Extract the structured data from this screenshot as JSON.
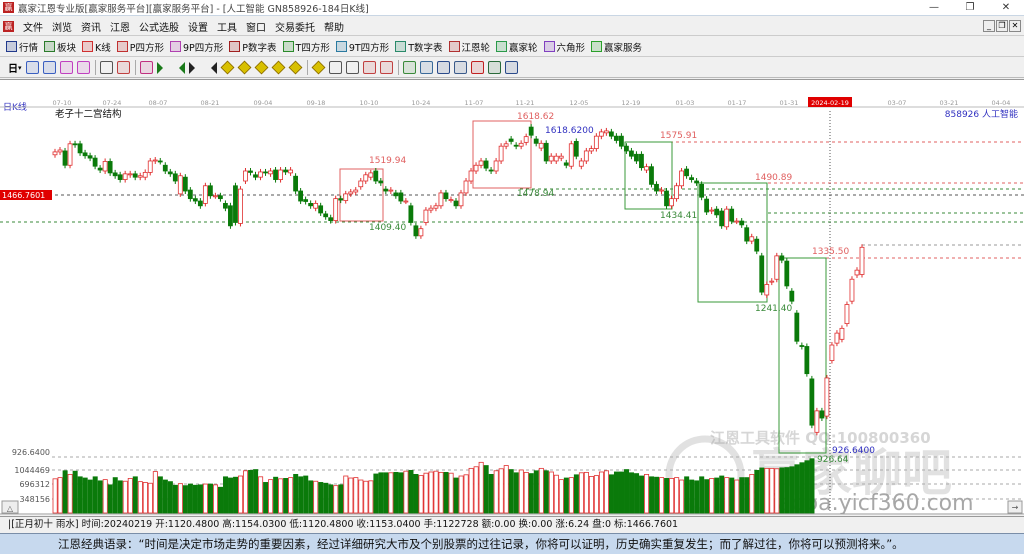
{
  "window": {
    "title": "赢家江恩专业版[赢家服务平台][赢家服务平台] - [人工智能  GN858926-184日K线]",
    "controls": [
      "—",
      "❐",
      "✕"
    ]
  },
  "menu": [
    "文件",
    "浏览",
    "资讯",
    "江恩",
    "公式选股",
    "设置",
    "工具",
    "窗口",
    "交易委托",
    "帮助"
  ],
  "toolbar1": [
    {
      "label": "行情",
      "icon": "quotes-icon",
      "color": "#223a8c"
    },
    {
      "label": "板块",
      "icon": "sector-icon",
      "color": "#2a7a2a"
    },
    {
      "label": "K线",
      "icon": "kline-icon",
      "color": "#d03030"
    },
    {
      "label": "P四方形",
      "icon": "p-square-icon",
      "color": "#c03030"
    },
    {
      "label": "9P四方形",
      "icon": "9p-square-icon",
      "color": "#b040b0"
    },
    {
      "label": "P数字表",
      "icon": "p-number-table-icon",
      "color": "#a02020"
    },
    {
      "label": "T四方形",
      "icon": "t-square-icon",
      "color": "#2a8a2a"
    },
    {
      "label": "9T四方形",
      "icon": "9t-square-icon",
      "color": "#2a7aa0"
    },
    {
      "label": "T数字表",
      "icon": "t-number-table-icon",
      "color": "#2a8a6a"
    },
    {
      "label": "江恩轮",
      "icon": "gann-wheel-icon",
      "color": "#b03030"
    },
    {
      "label": "赢家轮",
      "icon": "winner-wheel-icon",
      "color": "#2a9a4a"
    },
    {
      "label": "六角形",
      "icon": "hexagon-icon",
      "color": "#8040c0"
    },
    {
      "label": "赢家服务",
      "icon": "dollar-icon",
      "color": "#2aa02a"
    }
  ],
  "toolbar2": {
    "period": "日",
    "icons": [
      "overlay-icon",
      "info-icon",
      "indicator-icon",
      "indicator2-icon",
      "candle-type-icon",
      "right-icon",
      "flag-icon",
      "first-icon",
      "last-icon",
      "prev-icon",
      "next-icon",
      "zoom-in-icon",
      "zoom-out-icon",
      "shift-left-icon",
      "shift-right-icon",
      "expand-icon",
      "shrink-icon",
      "hand-icon",
      "crosshair-icon",
      "draw-line-icon",
      "pattern-icon",
      "gann-icon",
      "calendar-icon",
      "calculator-icon",
      "report-icon",
      "save-icon",
      "network-icon",
      "print-icon"
    ]
  },
  "chart": {
    "period_label": "日K线",
    "indicator_name": "老子十二宫结构",
    "symbol": "858926 人工智能",
    "current_price_tag": "1466.7601",
    "date_ticks": [
      "07-10",
      "07-24",
      "08-07",
      "08-21",
      "09-04",
      "09-18",
      "10-10",
      "10-24",
      "11-07",
      "11-21",
      "12-05",
      "12-19",
      "01-03",
      "01-17",
      "01-31",
      "2024-02-19",
      "03-07",
      "03-21",
      "04-04"
    ],
    "price_labels": {
      "a": "1519.94",
      "b": "1409.40",
      "c": "1618.62",
      "d": "1618.6200",
      "e": "1478.94",
      "f": "1575.91",
      "g": "1434.41",
      "h": "1490.89",
      "i": "1241.40",
      "j": "1335.50",
      "k": "926.6400",
      "l": "926.64"
    },
    "volume_axis": {
      "max_label": "926.6400",
      "ticks": [
        "1044469",
        "696312",
        "348156"
      ]
    },
    "watermark": {
      "line1": "江恩工具软件  QQ:100800360",
      "brand": "赢家聊吧",
      "site": "liaoba.yicf360.com"
    },
    "colors": {
      "up": "#e03030",
      "down": "#0a7a0a",
      "box_up": "#e06060",
      "box_down": "#3a9a3a",
      "tag": "#e00000",
      "blue": "#3030c0"
    }
  },
  "chart_data": {
    "type": "candlestick",
    "price_format": "[open, close]",
    "candles": [
      [
        1552,
        1558
      ],
      [
        1558,
        1562
      ],
      [
        1560,
        1530
      ],
      [
        1530,
        1575
      ],
      [
        1575,
        1573
      ],
      [
        1575,
        1556
      ],
      [
        1556,
        1550
      ],
      [
        1550,
        1545
      ],
      [
        1545,
        1528
      ],
      [
        1524,
        1520
      ],
      [
        1518,
        1538
      ],
      [
        1538,
        1514
      ],
      [
        1514,
        1508
      ],
      [
        1510,
        1500
      ],
      [
        1500,
        1512
      ],
      [
        1510,
        1512
      ],
      [
        1512,
        1505
      ],
      [
        1505,
        1508
      ],
      [
        1505,
        1515
      ],
      [
        1515,
        1539
      ],
      [
        1539,
        1541
      ],
      [
        1539,
        1538
      ],
      [
        1530,
        1518
      ],
      [
        1516,
        1512
      ],
      [
        1512,
        1497
      ],
      [
        1470,
        1508
      ],
      [
        1505,
        1476
      ],
      [
        1478,
        1460
      ],
      [
        1460,
        1455
      ],
      [
        1455,
        1445
      ],
      [
        1450,
        1487
      ],
      [
        1487,
        1466
      ],
      [
        1466,
        1466
      ],
      [
        1466,
        1460
      ],
      [
        1450,
        1440
      ],
      [
        1445,
        1403
      ],
      [
        1487,
        1410
      ],
      [
        1408,
        1480
      ],
      [
        1497,
        1518
      ],
      [
        1518,
        1515
      ],
      [
        1510,
        1505
      ],
      [
        1505,
        1516
      ],
      [
        1516,
        1514
      ],
      [
        1512,
        1518
      ],
      [
        1520,
        1500
      ],
      [
        1500,
        1520
      ],
      [
        1520,
        1516
      ],
      [
        1514,
        1520
      ],
      [
        1507,
        1476
      ],
      [
        1476,
        1455
      ],
      [
        1458,
        1454
      ],
      [
        1450,
        1445
      ],
      [
        1440,
        1450
      ],
      [
        1445,
        1430
      ],
      [
        1428,
        1422
      ],
      [
        1420,
        1414
      ],
      [
        1414,
        1460
      ],
      [
        1460,
        1457
      ],
      [
        1456,
        1470
      ],
      [
        1470,
        1474
      ],
      [
        1474,
        1478
      ],
      [
        1485,
        1497
      ],
      [
        1497,
        1510
      ],
      [
        1505,
        1514
      ],
      [
        1518,
        1497
      ],
      [
        1497,
        1493
      ],
      [
        1480,
        1476
      ],
      [
        1476,
        1478
      ],
      [
        1472,
        1466
      ],
      [
        1472,
        1455
      ],
      [
        1455,
        1455
      ],
      [
        1445,
        1410
      ],
      [
        1403,
        1382
      ],
      [
        1382,
        1397
      ],
      [
        1410,
        1436
      ],
      [
        1436,
        1440
      ],
      [
        1440,
        1445
      ],
      [
        1445,
        1472
      ],
      [
        1472,
        1460
      ],
      [
        1458,
        1458
      ],
      [
        1455,
        1445
      ],
      [
        1445,
        1472
      ],
      [
        1472,
        1497
      ],
      [
        1497,
        1518
      ],
      [
        1518,
        1530
      ],
      [
        1530,
        1539
      ],
      [
        1539,
        1524
      ],
      [
        1520,
        1518
      ],
      [
        1518,
        1539
      ],
      [
        1539,
        1570
      ],
      [
        1570,
        1575
      ],
      [
        1585,
        1580
      ],
      [
        1572,
        1570
      ],
      [
        1570,
        1576
      ],
      [
        1578,
        1590
      ],
      [
        1610,
        1593
      ],
      [
        1585,
        1576
      ],
      [
        1566,
        1576
      ],
      [
        1576,
        1539
      ],
      [
        1539,
        1549
      ],
      [
        1539,
        1549
      ],
      [
        1545,
        1549
      ],
      [
        1535,
        1530
      ],
      [
        1528,
        1575
      ],
      [
        1580,
        1549
      ],
      [
        1528,
        1539
      ],
      [
        1539,
        1560
      ],
      [
        1560,
        1565
      ],
      [
        1565,
        1591
      ],
      [
        1591,
        1600
      ],
      [
        1598,
        1602
      ],
      [
        1600,
        1591
      ],
      [
        1591,
        1582
      ],
      [
        1591,
        1570
      ],
      [
        1570,
        1560
      ],
      [
        1560,
        1549
      ],
      [
        1553,
        1539
      ],
      [
        1553,
        1525
      ],
      [
        1520,
        1527
      ],
      [
        1527,
        1490
      ],
      [
        1490,
        1476
      ],
      [
        1476,
        1478
      ],
      [
        1476,
        1445
      ],
      [
        1445,
        1460
      ],
      [
        1460,
        1487
      ],
      [
        1487,
        1518
      ],
      [
        1522,
        1508
      ],
      [
        1504,
        1500
      ],
      [
        1497,
        1493
      ],
      [
        1490,
        1463
      ],
      [
        1459,
        1432
      ],
      [
        1434,
        1436
      ],
      [
        1438,
        1426
      ],
      [
        1434,
        1403
      ],
      [
        1401,
        1438
      ],
      [
        1438,
        1413
      ],
      [
        1413,
        1413
      ],
      [
        1413,
        1405
      ],
      [
        1399,
        1371
      ],
      [
        1371,
        1380
      ],
      [
        1375,
        1350
      ],
      [
        1340,
        1264
      ],
      [
        1258,
        1280
      ],
      [
        1285,
        1287
      ],
      [
        1291,
        1340
      ],
      [
        1340,
        1331
      ],
      [
        1329,
        1277
      ],
      [
        1266,
        1245
      ],
      [
        1220,
        1161
      ],
      [
        1152,
        1150
      ],
      [
        1150,
        1093
      ],
      [
        1082,
        985
      ],
      [
        970,
        1015
      ],
      [
        1015,
        1000
      ],
      [
        1004,
        1084
      ],
      [
        1120.48,
        1153.04
      ],
      [
        1157,
        1178
      ],
      [
        1165,
        1188
      ],
      [
        1198,
        1238
      ],
      [
        1245,
        1291
      ],
      [
        1300,
        1310
      ],
      [
        1301,
        1358
      ]
    ],
    "volumes": [
      850000,
      880000,
      1050000,
      960000,
      1040000,
      900000,
      870000,
      820000,
      900000,
      800000,
      830000,
      700000,
      880000,
      800000,
      790000,
      860000,
      900000,
      780000,
      760000,
      740000,
      1030000,
      900000,
      820000,
      780000,
      690000,
      730000,
      680000,
      720000,
      690000,
      700000,
      720000,
      720000,
      700000,
      640000,
      900000,
      870000,
      890000,
      920000,
      1050000,
      1060000,
      1080000,
      900000,
      760000,
      830000,
      890000,
      850000,
      860000,
      880000,
      960000,
      900000,
      920000,
      800000,
      790000,
      760000,
      740000,
      700000,
      680000,
      700000,
      920000,
      870000,
      880000,
      820000,
      790000,
      800000,
      970000,
      1000000,
      1000000,
      1000000,
      1010000,
      1000000,
      1040000,
      1060000,
      960000,
      930000,
      990000,
      1020000,
      1040000,
      1010000,
      1010000,
      990000,
      870000,
      920000,
      950000,
      1110000,
      1150000,
      1260000,
      1180000,
      960000,
      1050000,
      1100000,
      1180000,
      1080000,
      1000000,
      1070000,
      1010000,
      980000,
      1050000,
      1110000,
      1050000,
      1020000,
      940000,
      830000,
      870000,
      880000,
      950000,
      1000000,
      1010000,
      910000,
      930000,
      1020000,
      1050000,
      950000,
      1020000,
      1020000,
      1080000,
      1000000,
      980000,
      920000,
      960000,
      900000,
      890000,
      880000,
      860000,
      860000,
      880000,
      820000,
      900000,
      820000,
      800000,
      900000,
      830000,
      860000,
      870000,
      920000,
      880000,
      870000,
      820000,
      880000,
      880000,
      960000,
      1060000,
      1120000,
      1110000,
      1110000,
      1100000,
      1122728,
      1130000,
      1150000,
      1200000,
      1250000,
      1300000,
      1350000
    ],
    "selected": {
      "date": "20240219"
    },
    "ylim": [
      926.64,
      1618.62
    ]
  },
  "status": "|[正月初十 雨水] 时间:20240219 开:1120.4800 高:1154.0300 低:1120.4800 收:1153.0400 手:1122728 额:0.00 换:0.00 涨:6.24 盘:0 标:1466.7601",
  "quote": "江恩经典语录：“时间是决定市场走势的重要因素，经过详细研究大市及个别股票的过往记录，你将可以证明，历史确实重复发生；而了解过往，你将可以预测将来。”。"
}
